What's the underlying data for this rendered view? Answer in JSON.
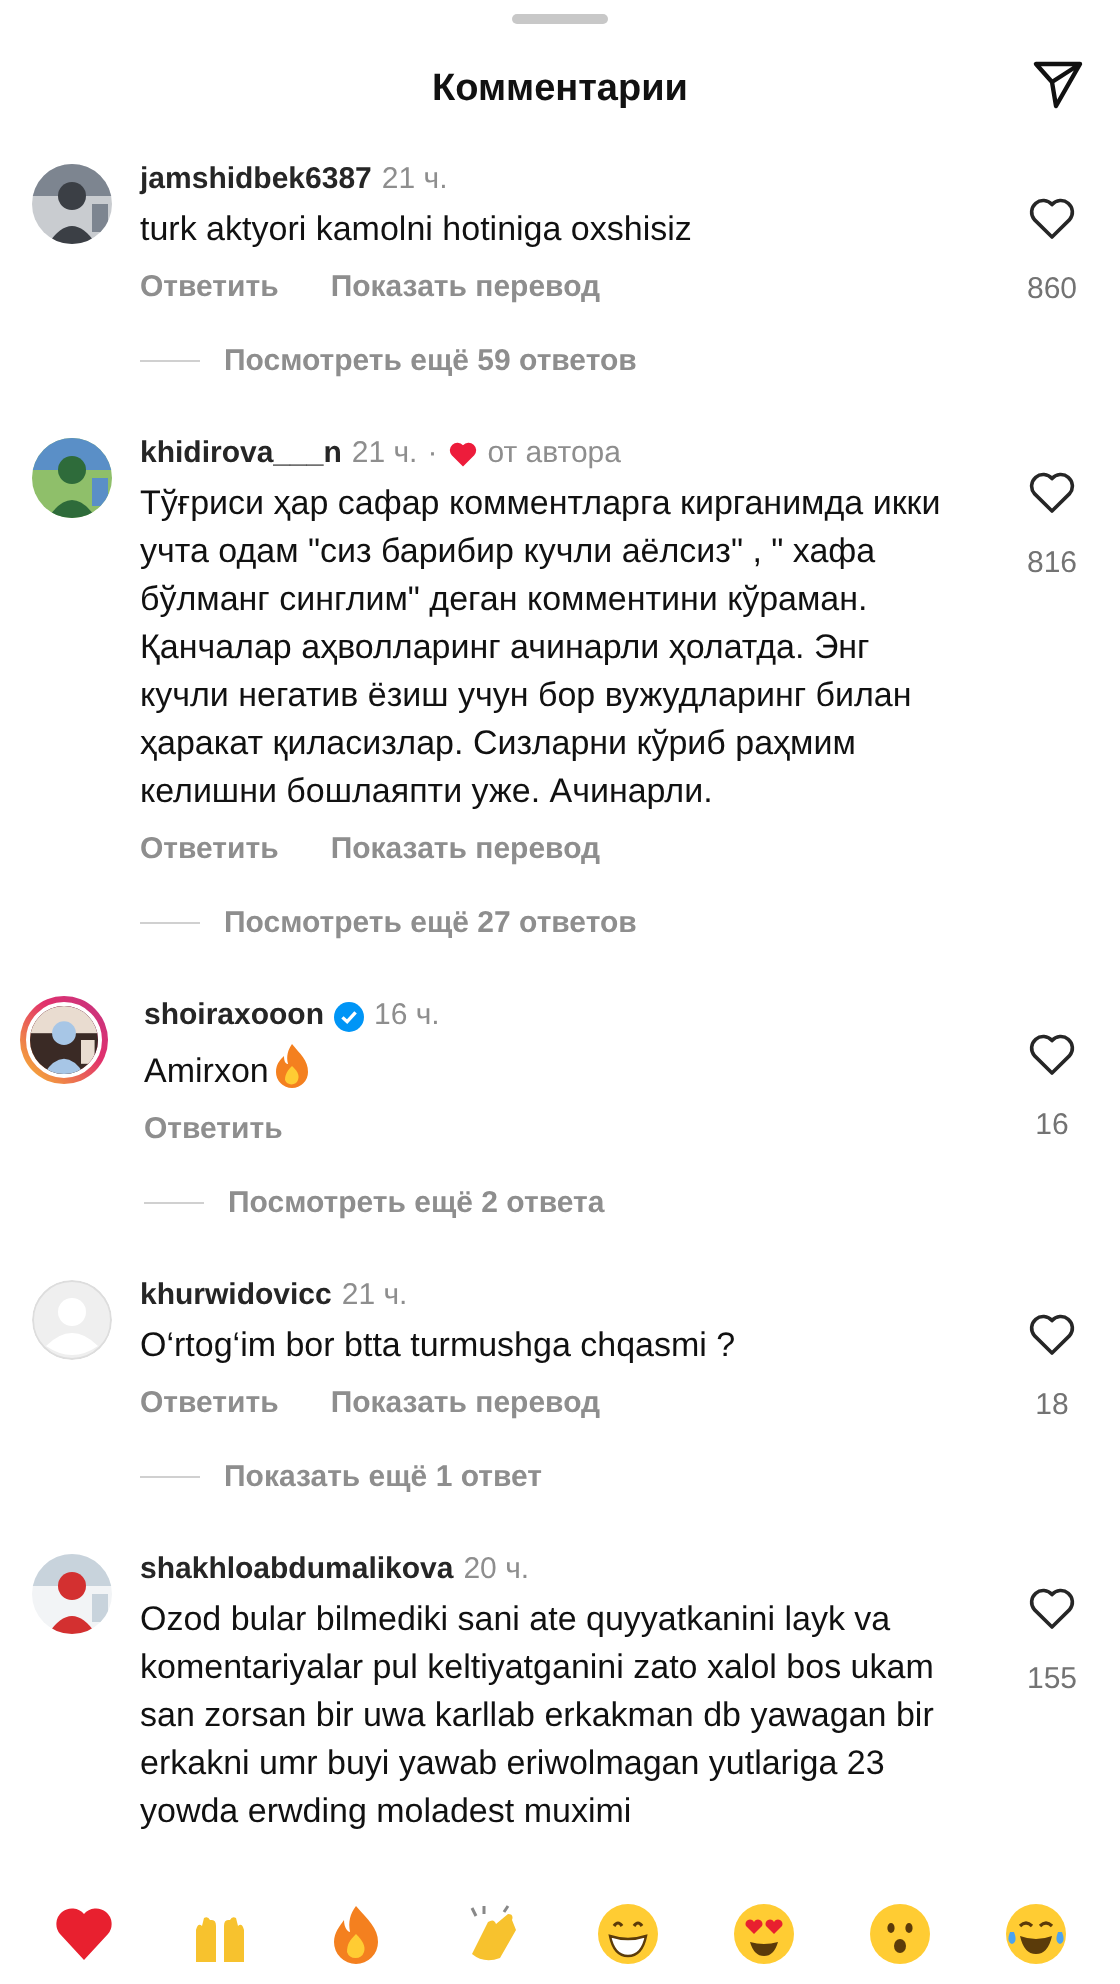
{
  "header": {
    "title": "Комментарии"
  },
  "comments": [
    {
      "avatar": {
        "kind": "picture",
        "story": false
      },
      "username": "jamshidbek6387",
      "verified": false,
      "time": "21 ч.",
      "author_liked": false,
      "text": "turk aktyori kamolni hotiniga oxshisiz",
      "emoji": false,
      "actions": [
        "Ответить",
        "Показать перевод"
      ],
      "likes": "860",
      "replies": "Посмотреть ещё 59 ответов"
    },
    {
      "avatar": {
        "kind": "picture",
        "story": false
      },
      "username": "khidirova___n",
      "verified": false,
      "time": "21 ч.",
      "author_liked": true,
      "separator": "·",
      "author_label": "от автора",
      "text": "Тўғриси ҳар сафар комментларга кирганимда икки учта одам \"сиз барибир кучли аёлсиз\" , \" хафа бўлманг синглим\" деган комментини кўраман. Қанчалар аҳволларинг ачинарли ҳолатда. Энг кучли негатив ёзиш учун бор вужудларинг билан ҳаракат қиласизлар. Сизларни кўриб раҳмим келишни бошлаяпти уже. Ачинарли.",
      "emoji": false,
      "actions": [
        "Ответить",
        "Показать перевод"
      ],
      "likes": "816",
      "replies": "Посмотреть ещё 27 ответов"
    },
    {
      "avatar": {
        "kind": "picture",
        "story": true
      },
      "username": "shoiraxooon",
      "verified": true,
      "time": "16 ч.",
      "author_liked": false,
      "text": "Amirxon",
      "emoji": true,
      "actions": [
        "Ответить"
      ],
      "likes": "16",
      "replies": "Посмотреть ещё 2 ответа"
    },
    {
      "avatar": {
        "kind": "default",
        "story": false
      },
      "username": "khurwidovicc",
      "verified": false,
      "time": "21 ч.",
      "author_liked": false,
      "text": "O‘rtog‘im bor btta turmushga chqasmi ?",
      "emoji": false,
      "actions": [
        "Ответить",
        "Показать перевод"
      ],
      "likes": "18",
      "replies": "Показать ещё 1 ответ"
    },
    {
      "avatar": {
        "kind": "picture",
        "story": false
      },
      "username": "shakhloabdumalikova",
      "verified": false,
      "time": "20 ч.",
      "author_liked": false,
      "text": "Ozod bular bilmediki sani ate quyyatkanini layk va komentariyalar pul keltiyatganini zato xalol bos ukam san zorsan bir uwa karllab erkakman db yawagan bir erkakni umr buyi yawab eriwolmagan yutlariga 23 yowda erwding moladest muximi",
      "emoji": false,
      "likes": "155"
    }
  ],
  "reactions": [
    {
      "kind": "heart"
    },
    {
      "kind": "hands"
    },
    {
      "kind": "fire"
    },
    {
      "kind": "clap"
    },
    {
      "kind": "grin"
    },
    {
      "kind": "hearteyes"
    },
    {
      "kind": "wow"
    },
    {
      "kind": "joy"
    }
  ]
}
